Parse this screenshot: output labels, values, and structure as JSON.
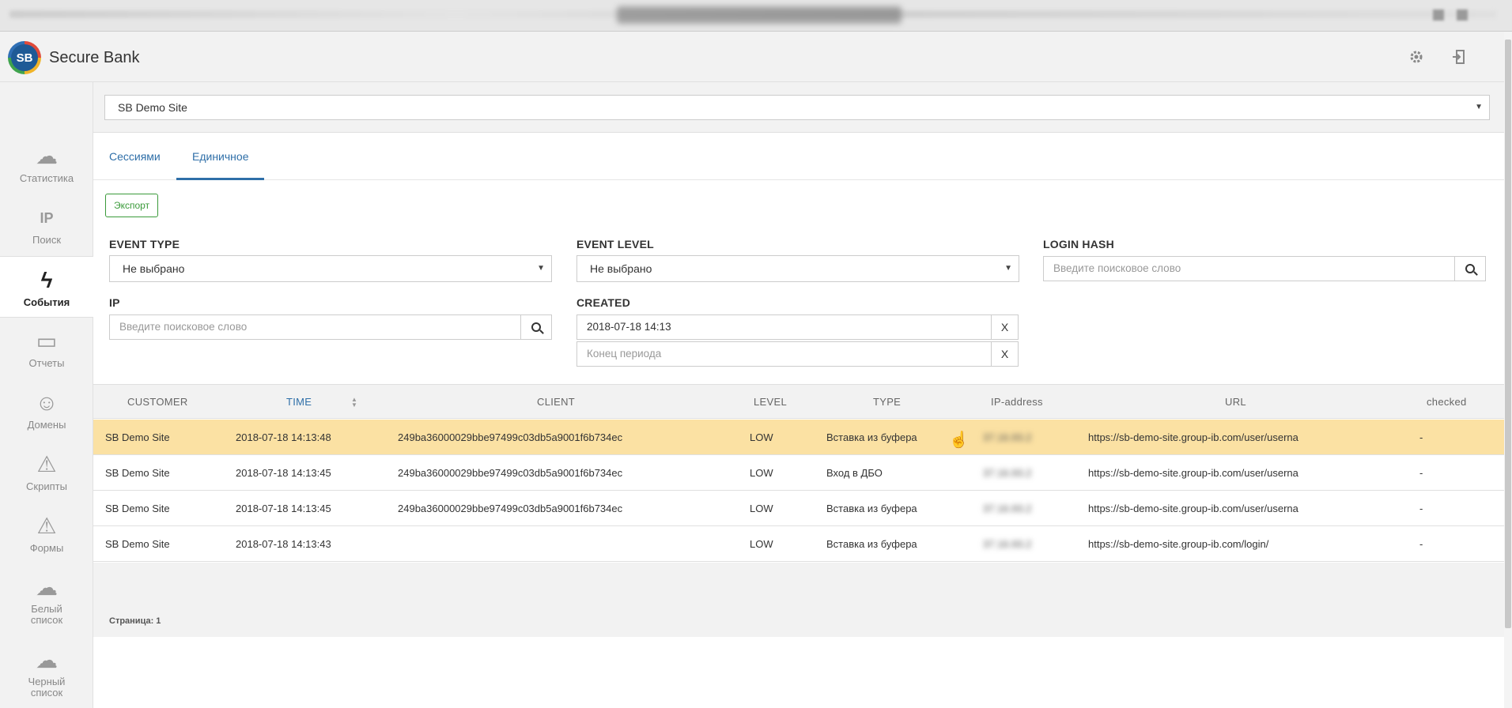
{
  "app": {
    "logo_text": "SB",
    "title": "Secure Bank"
  },
  "header": {
    "settings_icon": "gear-icon",
    "logout_icon": "logout-icon"
  },
  "site_select": {
    "value": "SB Demo Site"
  },
  "sidebar": {
    "items": [
      {
        "label": "Статистика",
        "icon": "cloud-stats-icon",
        "active": false
      },
      {
        "label": "Поиск",
        "icon": "ip-search-icon",
        "active": false
      },
      {
        "label": "События",
        "icon": "lightning-icon",
        "active": true
      },
      {
        "label": "Отчеты",
        "icon": "monitor-icon",
        "active": false
      },
      {
        "label": "Домены",
        "icon": "mask-icon",
        "active": false
      },
      {
        "label": "Скрипты",
        "icon": "warning-icon",
        "active": false
      },
      {
        "label": "Формы",
        "icon": "warning-icon",
        "active": false
      },
      {
        "label": "Белый список",
        "icon": "cloud-list-icon",
        "active": false
      },
      {
        "label": "Черный список",
        "icon": "cloud-list-icon",
        "active": false
      }
    ]
  },
  "tabs": [
    {
      "label": "Сессиями",
      "active": false
    },
    {
      "label": "Единичное",
      "active": true
    }
  ],
  "export_label": "Экспорт",
  "filters": {
    "event_type": {
      "label": "EVENT TYPE",
      "value": "Не выбрано"
    },
    "event_level": {
      "label": "EVENT LEVEL",
      "value": "Не выбрано"
    },
    "login_hash": {
      "label": "LOGIN HASH",
      "placeholder": "Введите поисковое слово"
    },
    "ip": {
      "label": "IP",
      "placeholder": "Введите поисковое слово"
    },
    "created": {
      "label": "CREATED",
      "start": "2018-07-18 14:13",
      "end_placeholder": "Конец периода",
      "clear": "X"
    }
  },
  "table": {
    "columns": [
      "CUSTOMER",
      "TIME",
      "CLIENT",
      "LEVEL",
      "TYPE",
      "IP-address",
      "URL",
      "checked"
    ],
    "sorted_column": "TIME",
    "rows": [
      {
        "customer": "SB Demo Site",
        "time": "2018-07-18 14:13:48",
        "client": "249ba36000029bbe97499c03db5a9001f6b734ec",
        "level": "LOW",
        "type": "Вставка из буфера",
        "ip": "37.16.93.2",
        "url": "https://sb-demo-site.group-ib.com/user/userna",
        "checked": "-",
        "highlighted": true
      },
      {
        "customer": "SB Demo Site",
        "time": "2018-07-18 14:13:45",
        "client": "249ba36000029bbe97499c03db5a9001f6b734ec",
        "level": "LOW",
        "type": "Вход в ДБО",
        "ip": "37.16.93.2",
        "url": "https://sb-demo-site.group-ib.com/user/userna",
        "checked": "-",
        "highlighted": false
      },
      {
        "customer": "SB Demo Site",
        "time": "2018-07-18 14:13:45",
        "client": "249ba36000029bbe97499c03db5a9001f6b734ec",
        "level": "LOW",
        "type": "Вставка из буфера",
        "ip": "37.16.93.2",
        "url": "https://sb-demo-site.group-ib.com/user/userna",
        "checked": "-",
        "highlighted": false
      },
      {
        "customer": "SB Demo Site",
        "time": "2018-07-18 14:13:43",
        "client": "",
        "level": "LOW",
        "type": "Вставка из буфера",
        "ip": "37.16.93.2",
        "url": "https://sb-demo-site.group-ib.com/login/",
        "checked": "-",
        "highlighted": false
      }
    ]
  },
  "pagination": {
    "label": "Страница: 1"
  },
  "colors": {
    "accent": "#2f6fa8",
    "highlight_row": "#fbe1a3",
    "export_green": "#3a9a3a"
  }
}
